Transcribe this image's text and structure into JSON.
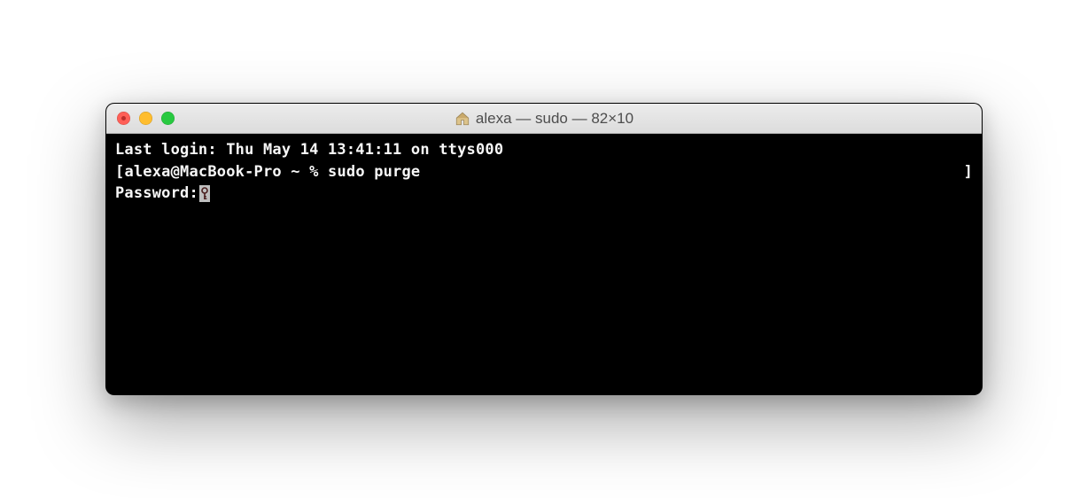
{
  "window": {
    "title": "alexa — sudo — 82×10",
    "icon": "home-icon"
  },
  "traffic_lights": {
    "close": "close",
    "minimize": "minimize",
    "maximize": "maximize"
  },
  "terminal": {
    "last_login": "Last login: Thu May 14 13:41:11 on ttys000",
    "prompt_open": "[",
    "prompt": "alexa@MacBook-Pro ~ % ",
    "command": "sudo purge",
    "prompt_close": "]",
    "password_label": "Password:",
    "cursor_icon": "key-icon"
  }
}
